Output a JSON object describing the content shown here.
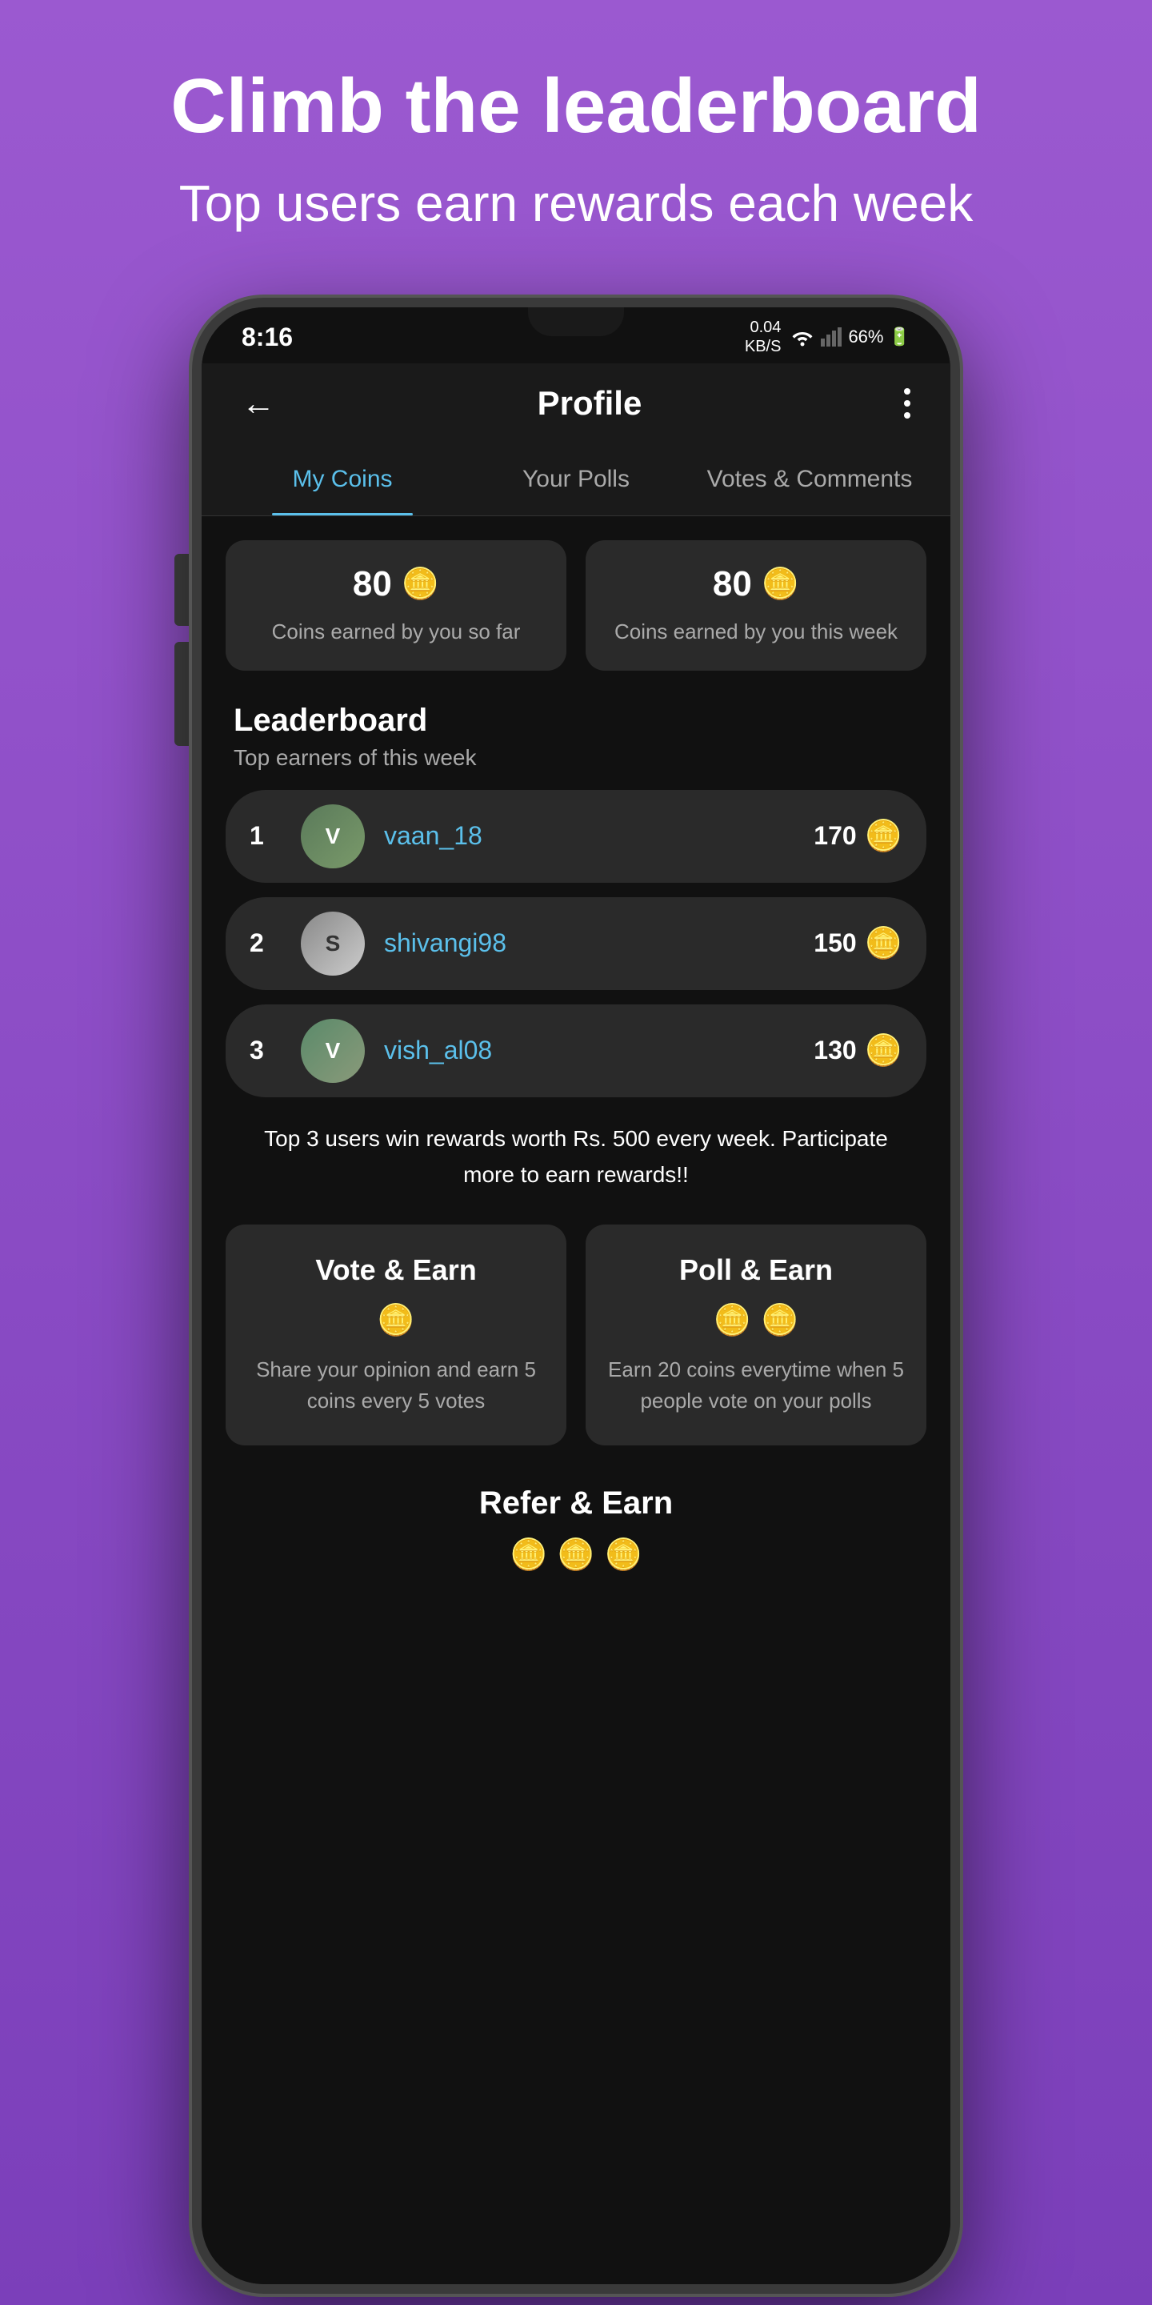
{
  "page": {
    "background_color": "#9b59d0",
    "hero": {
      "title": "Climb the leaderboard",
      "subtitle": "Top users earn rewards each week"
    },
    "status_bar": {
      "time": "8:16",
      "data_speed": "0.04",
      "data_unit": "KB/S",
      "battery": "66%"
    },
    "header": {
      "back_label": "←",
      "title": "Profile",
      "more_label": "⋮"
    },
    "tabs": [
      {
        "id": "my-coins",
        "label": "My Coins",
        "active": true
      },
      {
        "id": "your-polls",
        "label": "Your Polls",
        "active": false
      },
      {
        "id": "votes-comments",
        "label": "Votes & Comments",
        "active": false
      }
    ],
    "coins_cards": [
      {
        "id": "total-coins",
        "amount": "80",
        "coin_icon": "🪙",
        "label": "Coins earned by you so far"
      },
      {
        "id": "weekly-coins",
        "amount": "80",
        "coin_icon": "🪙",
        "label": "Coins earned by you this week"
      }
    ],
    "leaderboard": {
      "title": "Leaderboard",
      "subtitle": "Top earners of this week",
      "entries": [
        {
          "rank": 1,
          "username": "vaan_18",
          "score": 170,
          "avatar_initials": "V"
        },
        {
          "rank": 2,
          "username": "shivangi98",
          "score": 150,
          "avatar_initials": "S"
        },
        {
          "rank": 3,
          "username": "vish_al08",
          "score": 130,
          "avatar_initials": "V"
        }
      ],
      "reward_text": "Top 3 users win rewards worth Rs. 500 every week. Participate more to earn rewards!!"
    },
    "earn_cards": [
      {
        "id": "vote-earn",
        "title": "Vote & Earn",
        "coins": [
          "🪙"
        ],
        "description": "Share your opinion and earn 5 coins every 5 votes"
      },
      {
        "id": "poll-earn",
        "title": "Poll & Earn",
        "coins": [
          "🪙",
          "🪙"
        ],
        "description": "Earn 20 coins everytime when 5 people vote on your polls"
      }
    ],
    "refer_section": {
      "title": "Refer & Earn",
      "coins": [
        "🪙",
        "🪙",
        "🪙"
      ]
    }
  }
}
